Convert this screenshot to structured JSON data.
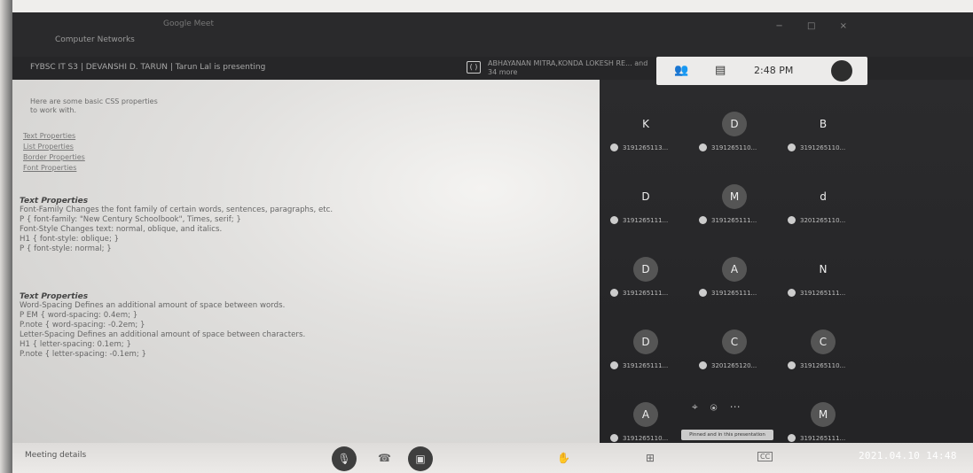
{
  "window": {
    "title": "Google Meet",
    "app_name": "Computer Networks",
    "controls": [
      "−",
      "□",
      "×"
    ]
  },
  "presenting": {
    "text": "FYBSC IT S3 | DEVANSHI D. TARUN | Tarun Lal is presenting",
    "others": "ABHAYANAN MITRA,KONDA LOKESH RE... and 34 more",
    "icon": "( )"
  },
  "status": {
    "people_icon": "people-icon",
    "people_glyph": "👥",
    "chat_icon": "chat-icon",
    "chat_glyph": "▤",
    "time": "2:48 PM"
  },
  "slide": {
    "intro": "Here are some basic CSS properties to work with.",
    "toc": [
      "Text Properties",
      "List Properties",
      "Border Properties",
      "Font Properties"
    ],
    "section1": {
      "title": "Text Properties",
      "lines": [
        "Font-Family Changes the font family of certain words, sentences, paragraphs, etc.",
        "P { font-family: \"New Century Schoolbook\", Times, serif; }",
        "Font-Style Changes text: normal, oblique, and italics.",
        "H1 { font-style: oblique; }",
        "P { font-style: normal; }"
      ]
    },
    "section2": {
      "title": "Text Properties",
      "lines": [
        "Word-Spacing Defines an additional amount of space between words.",
        "P EM { word-spacing: 0.4em; }",
        "P.note { word-spacing: -0.2em; }",
        "Letter-Spacing Defines an additional amount of space between characters.",
        "H1 { letter-spacing: 0.1em; }",
        "P.note { letter-spacing: -0.1em; }"
      ]
    }
  },
  "participants": [
    {
      "letter": "K",
      "name": "3191265113..."
    },
    {
      "letter": "D",
      "name": "3191265110..."
    },
    {
      "letter": "B",
      "name": "3191265110..."
    },
    {
      "letter": "D",
      "name": "3191265111..."
    },
    {
      "letter": "M",
      "name": "3191265111..."
    },
    {
      "letter": "d",
      "name": "3201265110..."
    },
    {
      "letter": "D",
      "name": "3191265111..."
    },
    {
      "letter": "A",
      "name": "3191265111..."
    },
    {
      "letter": "N",
      "name": "3191265111..."
    },
    {
      "letter": "D",
      "name": "3191265111..."
    },
    {
      "letter": "C",
      "name": "3201265120..."
    },
    {
      "letter": "C",
      "name": "3191265110..."
    },
    {
      "letter": "A",
      "name": "3191265110..."
    },
    {
      "letter": "",
      "name": ""
    },
    {
      "letter": "M",
      "name": "3191265111..."
    }
  ],
  "tile_hover": {
    "tooltip": "Pinned and in this presentation",
    "icons": [
      "pin-icon",
      "mic-icon",
      "more-icon"
    ]
  },
  "toolbar": {
    "left_label": "Meeting details",
    "mic_glyph": "🎙",
    "end_glyph": "☎",
    "camera_glyph": "▣",
    "hand_glyph": "✋",
    "present_glyph": "⊞",
    "captions_glyph": "CC"
  },
  "datestamp": "2021.04.10 14:48"
}
